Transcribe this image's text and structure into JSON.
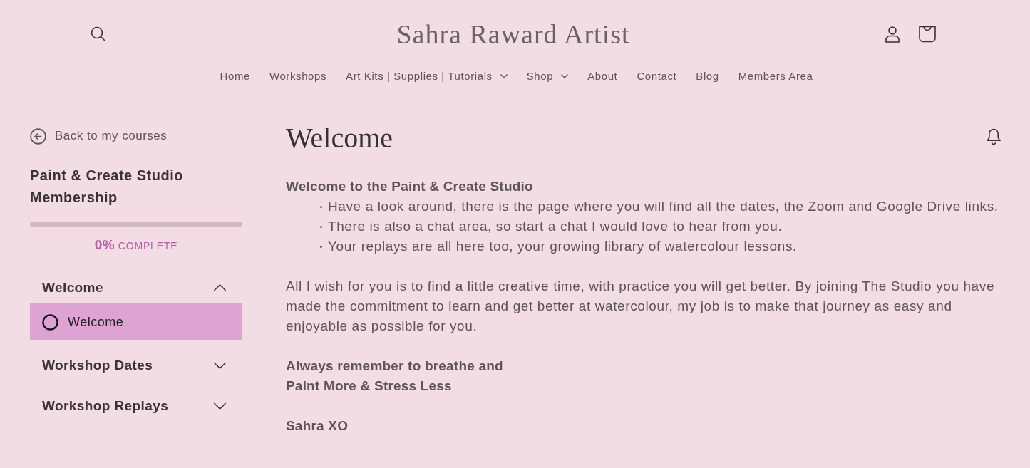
{
  "header": {
    "title": "Sahra Raward Artist"
  },
  "nav": [
    {
      "label": "Home",
      "has_dropdown": false
    },
    {
      "label": "Workshops",
      "has_dropdown": false
    },
    {
      "label": "Art Kits | Supplies | Tutorials",
      "has_dropdown": true
    },
    {
      "label": "Shop",
      "has_dropdown": true
    },
    {
      "label": "About",
      "has_dropdown": false
    },
    {
      "label": "Contact",
      "has_dropdown": false
    },
    {
      "label": "Blog",
      "has_dropdown": false
    },
    {
      "label": "Members Area",
      "has_dropdown": false
    }
  ],
  "sidebar": {
    "back_link": "Back to my courses",
    "course_title": "Paint & Create Studio Membership",
    "progress": {
      "level": 0,
      "percent": "0%",
      "label": "COMPLETE"
    },
    "sections": [
      {
        "title": "Welcome",
        "expanded": true,
        "lessons": [
          {
            "title": "Welcome",
            "selected": true,
            "completed": false
          }
        ]
      },
      {
        "title": "Workshop Dates",
        "expanded": false
      },
      {
        "title": "Workshop Replays",
        "expanded": false
      }
    ]
  },
  "main": {
    "heading": "Welcome",
    "blocks": [
      {
        "kind": "list",
        "title": "Welcome to the Paint & Create Studio",
        "items": [
          "Have a look around, there is the page where you will find all the dates, the Zoom and Google Drive links.",
          "There is also a chat area, so start a chat I would love to hear from you.",
          "Your replays are all here too, your growing library of watercolour lessons."
        ]
      },
      {
        "kind": "paragraph",
        "text": "All I wish for you is to find a little creative time, with practice you will get better. By joining The Studio you have made the commitment to learn and get better at watercolour, my job is to make that journey as easy and enjoyable as possible for you."
      },
      {
        "kind": "bold",
        "lines": [
          "Always remember to breathe and",
          "Paint More & Stress Less"
        ]
      },
      {
        "kind": "bold",
        "lines": [
          "Sahra XO"
        ]
      }
    ]
  }
}
